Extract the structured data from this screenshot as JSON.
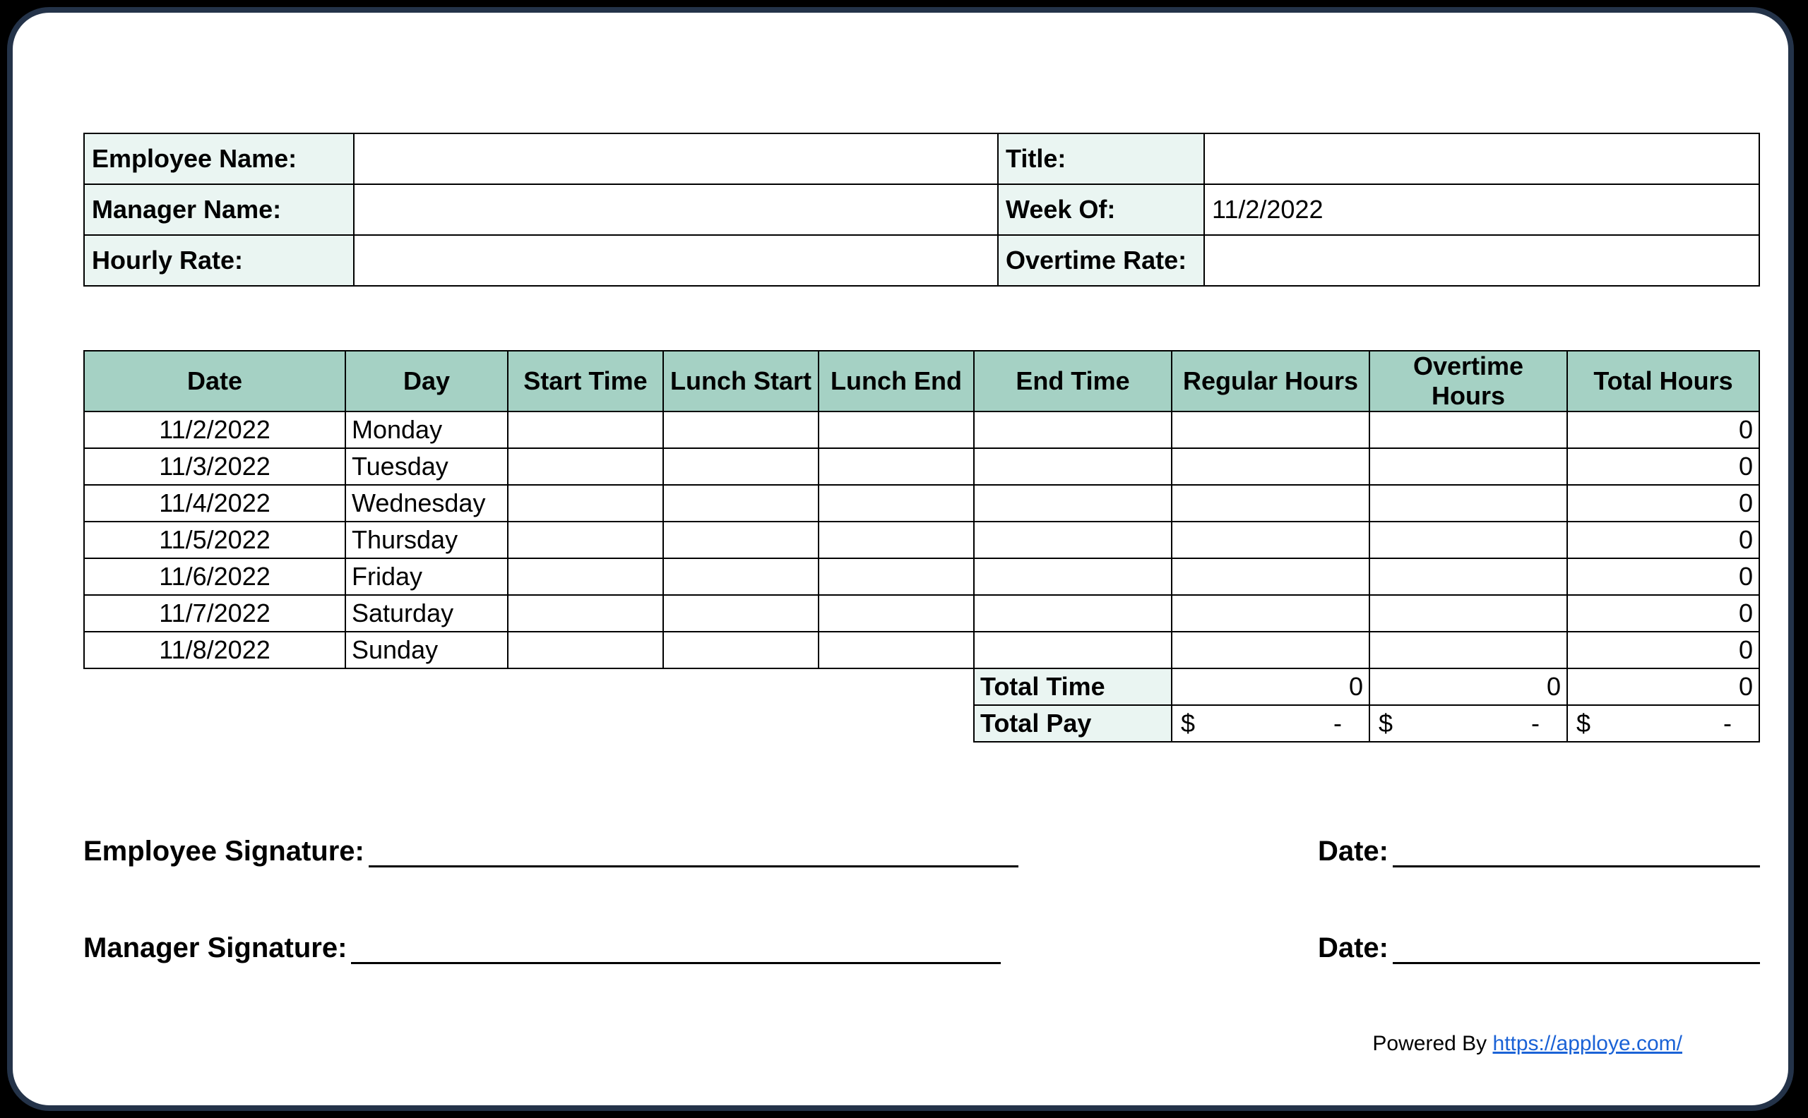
{
  "header": {
    "employee_name_label": "Employee Name:",
    "title_label": "Title:",
    "manager_name_label": "Manager Name:",
    "week_of_label": "Week Of:",
    "week_of_value": "11/2/2022",
    "hourly_rate_label": "Hourly Rate:",
    "overtime_rate_label": "Overtime Rate:"
  },
  "columns": {
    "date": "Date",
    "day": "Day",
    "start_time": "Start Time",
    "lunch_start": "Lunch Start",
    "lunch_end": "Lunch End",
    "end_time": "End Time",
    "regular_hours": "Regular Hours",
    "overtime_hours": "Overtime Hours",
    "total_hours": "Total Hours"
  },
  "rows": [
    {
      "date": "11/2/2022",
      "day": "Monday",
      "total": "0"
    },
    {
      "date": "11/3/2022",
      "day": "Tuesday",
      "total": "0"
    },
    {
      "date": "11/4/2022",
      "day": "Wednesday",
      "total": "0"
    },
    {
      "date": "11/5/2022",
      "day": "Thursday",
      "total": "0"
    },
    {
      "date": "11/6/2022",
      "day": "Friday",
      "total": "0"
    },
    {
      "date": "11/7/2022",
      "day": "Saturday",
      "total": "0"
    },
    {
      "date": "11/8/2022",
      "day": "Sunday",
      "total": "0"
    }
  ],
  "totals": {
    "total_time_label": "Total Time",
    "total_pay_label": "Total Pay",
    "regular_time": "0",
    "overtime_time": "0",
    "total_time": "0",
    "currency": "$",
    "dash": "-"
  },
  "signatures": {
    "employee_label": "Employee Signature:",
    "manager_label": "Manager Signature:",
    "date_label": "Date:"
  },
  "footer": {
    "powered_text": "Powered By ",
    "link_text": "https://apploye.com/"
  }
}
